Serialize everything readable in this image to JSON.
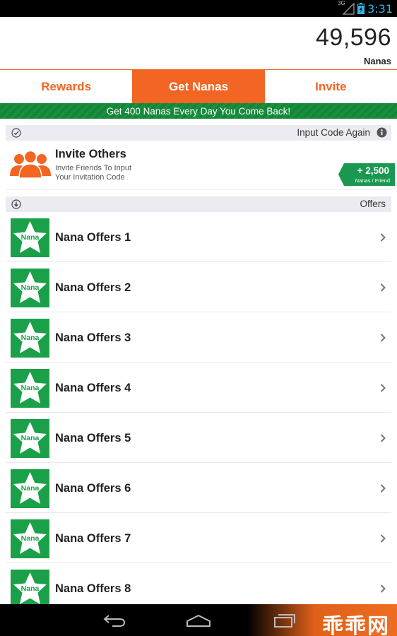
{
  "status_bar": {
    "signal_label": "3G",
    "time": "3:31"
  },
  "balance": {
    "value": "49,596",
    "unit": "Nanas"
  },
  "tabs": [
    {
      "label": "Rewards",
      "active": false
    },
    {
      "label": "Get Nanas",
      "active": true
    },
    {
      "label": "Invite",
      "active": false
    }
  ],
  "banner": "Get 400 Nanas Every Day You Come Back!",
  "input_code_section": {
    "label": "Input Code Again"
  },
  "invite": {
    "title": "Invite Others",
    "desc_line1": "Invite Friends To Input",
    "desc_line2": "Your Invitation Code",
    "reward_amount": "+ 2,500",
    "reward_unit": "Nanas / Friend"
  },
  "offers_section": {
    "label": "Offers"
  },
  "offers": [
    {
      "icon_text": "Nana",
      "label": "Nana Offers 1"
    },
    {
      "icon_text": "Nana",
      "label": "Nana Offers 2"
    },
    {
      "icon_text": "Nana",
      "label": "Nana Offers 3"
    },
    {
      "icon_text": "Nana",
      "label": "Nana Offers 4"
    },
    {
      "icon_text": "Nana",
      "label": "Nana Offers 5"
    },
    {
      "icon_text": "Nana",
      "label": "Nana Offers 6"
    },
    {
      "icon_text": "Nana",
      "label": "Nana Offers 7"
    },
    {
      "icon_text": "Nana",
      "label": "Nana Offers 8"
    }
  ],
  "watermark": "乖乖网",
  "colors": {
    "accent": "#f26522",
    "green": "#1aa049",
    "banner_green": "#1a8f3e",
    "section_bg": "#ecebf2",
    "clock": "#33b5e5"
  },
  "icons": {
    "signal": "signal-icon",
    "battery": "battery-charging-icon",
    "check": "check-circle-icon",
    "info": "info-icon",
    "download": "download-circle-icon",
    "invite": "people-group-icon",
    "offer": "star-icon",
    "chevron": "chevron-right-icon",
    "back": "back-icon",
    "home": "home-icon",
    "recents": "recent-apps-icon"
  }
}
